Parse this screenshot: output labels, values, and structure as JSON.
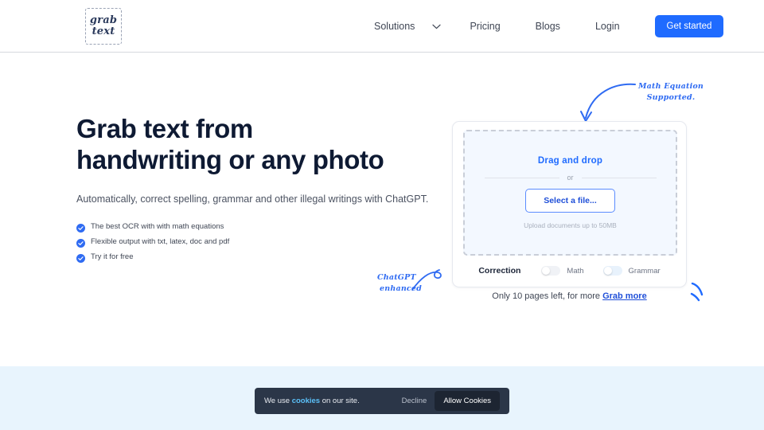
{
  "header": {
    "logo": {
      "line1": "grab",
      "line2": "text"
    },
    "nav": [
      {
        "label": "Solutions",
        "has_caret": true,
        "icon": "chevron-down-icon"
      },
      {
        "label": "Pricing",
        "has_caret": false
      },
      {
        "label": "Blogs",
        "has_caret": false
      },
      {
        "label": "Login",
        "has_caret": false
      }
    ],
    "cta_label": "Get started",
    "cta_color": "#1f6bff"
  },
  "hero": {
    "title_line1": "Grab text from",
    "title_line2": "handwriting or any photo",
    "subtitle": "Automatically, correct spelling, grammar and other illegal writings with ChatGPT.",
    "bullets": [
      {
        "icon": "check-circle-icon",
        "text": "The best OCR with with math equations"
      },
      {
        "icon": "check-circle-icon",
        "text": "Flexible output with txt, latex, doc and pdf"
      },
      {
        "icon": "check-circle-icon",
        "text": "Try it for free"
      }
    ]
  },
  "upload_card": {
    "drag_title": "Drag and drop",
    "or_text": "or",
    "select_file_label": "Select a file...",
    "upload_hint": "Upload documents up to 50MB",
    "correction_label": "Correction",
    "toggles": [
      {
        "name": "math",
        "label": "Math",
        "on": false
      },
      {
        "name": "grammar",
        "label": "Grammar",
        "on": false
      }
    ],
    "pages_left_text": "Only 10 pages left, for more",
    "grab_more_label": "Grab more"
  },
  "annotations": {
    "math_note_line1": "Math Equation",
    "math_note_line2": "Supported.",
    "chat_note_line1": "ChatGPT",
    "chat_note_line2": "enhanced",
    "color": "#2f6bf2"
  },
  "cookie_banner": {
    "text_before": "We use ",
    "highlight": "cookies",
    "text_after": " on our site.",
    "decline_label": "Decline",
    "allow_label": "Allow Cookies"
  }
}
